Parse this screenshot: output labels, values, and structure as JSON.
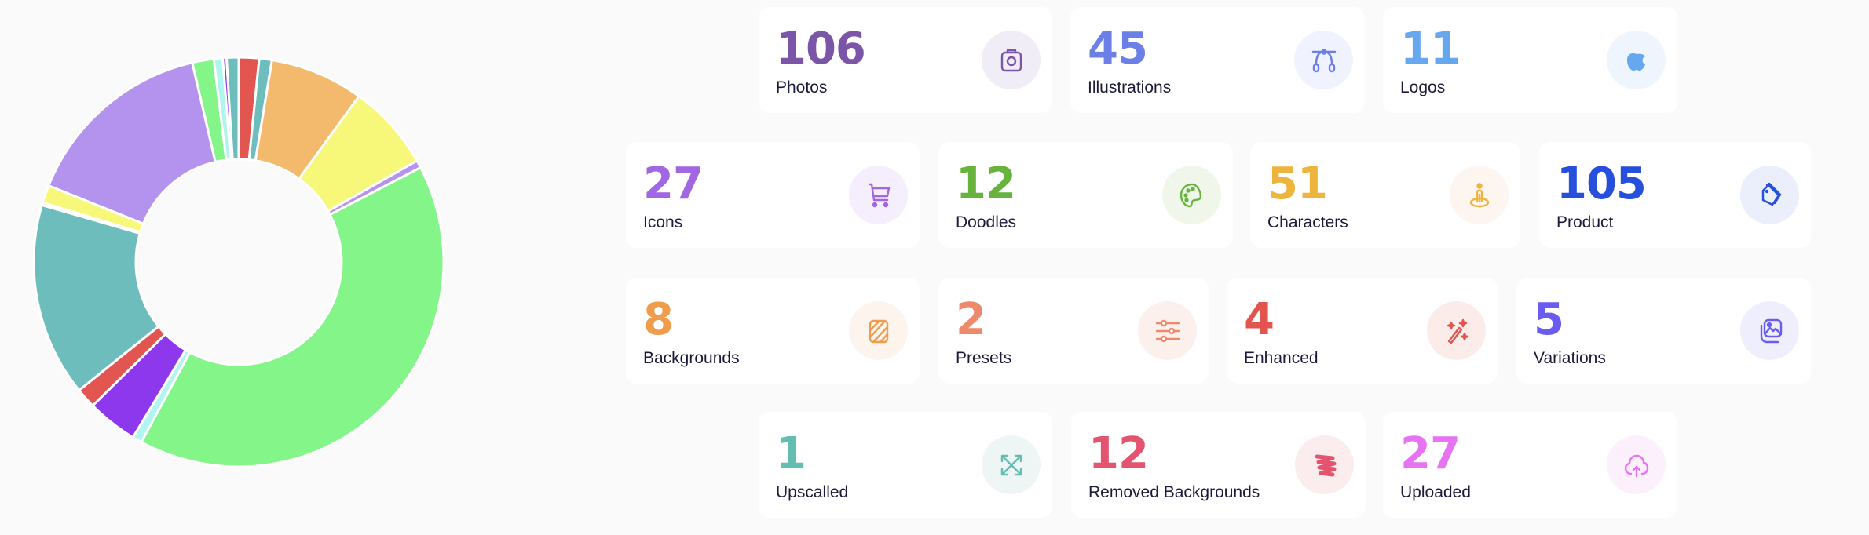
{
  "chart_data": {
    "type": "pie",
    "variant": "donut",
    "unit": "percent",
    "legend": "none",
    "slices": [
      {
        "value": 1.6,
        "color": "#e25550"
      },
      {
        "value": 1.0,
        "color": "#6dbdbd"
      },
      {
        "value": 7.4,
        "color": "#f3b96c"
      },
      {
        "value": 6.8,
        "color": "#f7f77a"
      },
      {
        "value": 0.6,
        "color": "#b393ee"
      },
      {
        "value": 40.6,
        "color": "#83f589"
      },
      {
        "value": 0.75,
        "color": "#b0f5ee"
      },
      {
        "value": 4.0,
        "color": "#8d38ec"
      },
      {
        "value": 1.6,
        "color": "#e25550"
      },
      {
        "value": 15.3,
        "color": "#6dbdbd"
      },
      {
        "value": 0.2,
        "color": "#f3b96c"
      },
      {
        "value": 1.4,
        "color": "#f7f77a"
      },
      {
        "value": 15.3,
        "color": "#b393ee"
      },
      {
        "value": 1.7,
        "color": "#83f589"
      },
      {
        "value": 0.7,
        "color": "#b0f5ee"
      },
      {
        "value": 0.3,
        "color": "#8d38ec"
      },
      {
        "value": 0.95,
        "color": "#6dbdbd"
      }
    ]
  },
  "stats": [
    {
      "value": "106",
      "label": "Photos",
      "icon": "camera-icon",
      "color": "#7b55a8",
      "bg": "#f1edf7"
    },
    {
      "value": "45",
      "label": "Illustrations",
      "icon": "bezier-curve-icon",
      "color": "#6b7fe6",
      "bg": "#f0f2fd"
    },
    {
      "value": "11",
      "label": "Logos",
      "icon": "apple-logo-icon",
      "color": "#67a7ee",
      "bg": "#eff5fc"
    },
    {
      "value": "27",
      "label": "Icons",
      "icon": "shopping-cart-icon",
      "color": "#a066e4",
      "bg": "#f5effd"
    },
    {
      "value": "12",
      "label": "Doodles",
      "icon": "palette-icon",
      "color": "#68b23e",
      "bg": "#f0f7ea"
    },
    {
      "value": "51",
      "label": "Characters",
      "icon": "person-pin-icon",
      "color": "#eeb53e",
      "bg": "#fdf5ef"
    },
    {
      "value": "105",
      "label": "Product",
      "icon": "tags-icon",
      "color": "#2650db",
      "bg": "#ebeffb"
    },
    {
      "value": "8",
      "label": "Backgrounds",
      "icon": "pattern-icon",
      "color": "#ef9c4c",
      "bg": "#fdf4ee"
    },
    {
      "value": "2",
      "label": "Presets",
      "icon": "sliders-icon",
      "color": "#ee8a6c",
      "bg": "#fcf0ec"
    },
    {
      "value": "4",
      "label": "Enhanced",
      "icon": "magic-wand-icon",
      "color": "#e2554e",
      "bg": "#fbecea"
    },
    {
      "value": "5",
      "label": "Variations",
      "icon": "image-stack-icon",
      "color": "#6a5cf0",
      "bg": "#efeefd"
    },
    {
      "value": "1",
      "label": "Upscalled",
      "icon": "expand-arrows-icon",
      "color": "#63bdb1",
      "bg": "#edf6f5"
    },
    {
      "value": "12",
      "label": "Removed Backgrounds",
      "icon": "scribble-icon",
      "color": "#e4546f",
      "bg": "#fbedee"
    },
    {
      "value": "27",
      "label": "Uploaded",
      "icon": "cloud-upload-icon",
      "color": "#e573f2",
      "bg": "#fcf0fd"
    }
  ]
}
